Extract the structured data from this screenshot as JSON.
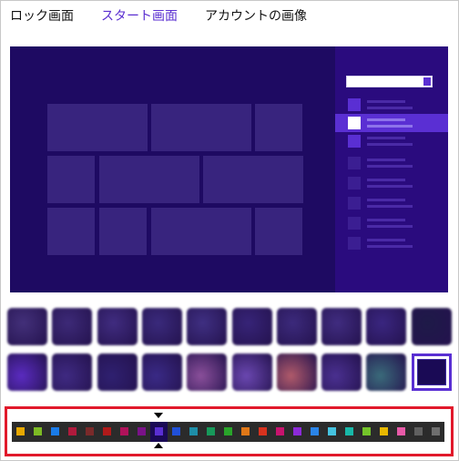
{
  "tabs": {
    "lock": "ロック画面",
    "start": "スタート画面",
    "account": "アカウントの画像"
  },
  "colors": {
    "accent": "#5a2ed0",
    "preview_bg": "#1e0a62",
    "highlight_border": "#e1192b"
  },
  "thumbnails_row1": [
    "#43307a",
    "#3d2a78",
    "#402c80",
    "#3a2a7c",
    "#3f2f82",
    "#372478",
    "#3c2a7c",
    "#402c80",
    "#3a2680",
    "#1e1a48"
  ],
  "thumbnails_row2": [
    "#5a2bc0",
    "#3f2a82",
    "#2f2070",
    "#3a2a86",
    "#8a4f9a",
    "#6a47b0",
    "#b05a6a",
    "#4a3090",
    "#3a6a7a",
    "selected"
  ],
  "color_swatches": [
    "#e8a800",
    "#7dbb24",
    "#1a7be8",
    "#b01a3c",
    "#7a2a2a",
    "#b01a1a",
    "#b0125a",
    "#7a1288",
    "#5a2fd3",
    "#2050d8",
    "#1e8ea8",
    "#17995a",
    "#29a52a",
    "#e07818",
    "#d8321e",
    "#c8136e",
    "#8c2ad8",
    "#2a84e8",
    "#45c3e0",
    "#18b8a8",
    "#74c42a",
    "#e8b800",
    "#e85aa8",
    "#606060",
    "#6e6e6e"
  ],
  "selected_swatch_index": 8
}
